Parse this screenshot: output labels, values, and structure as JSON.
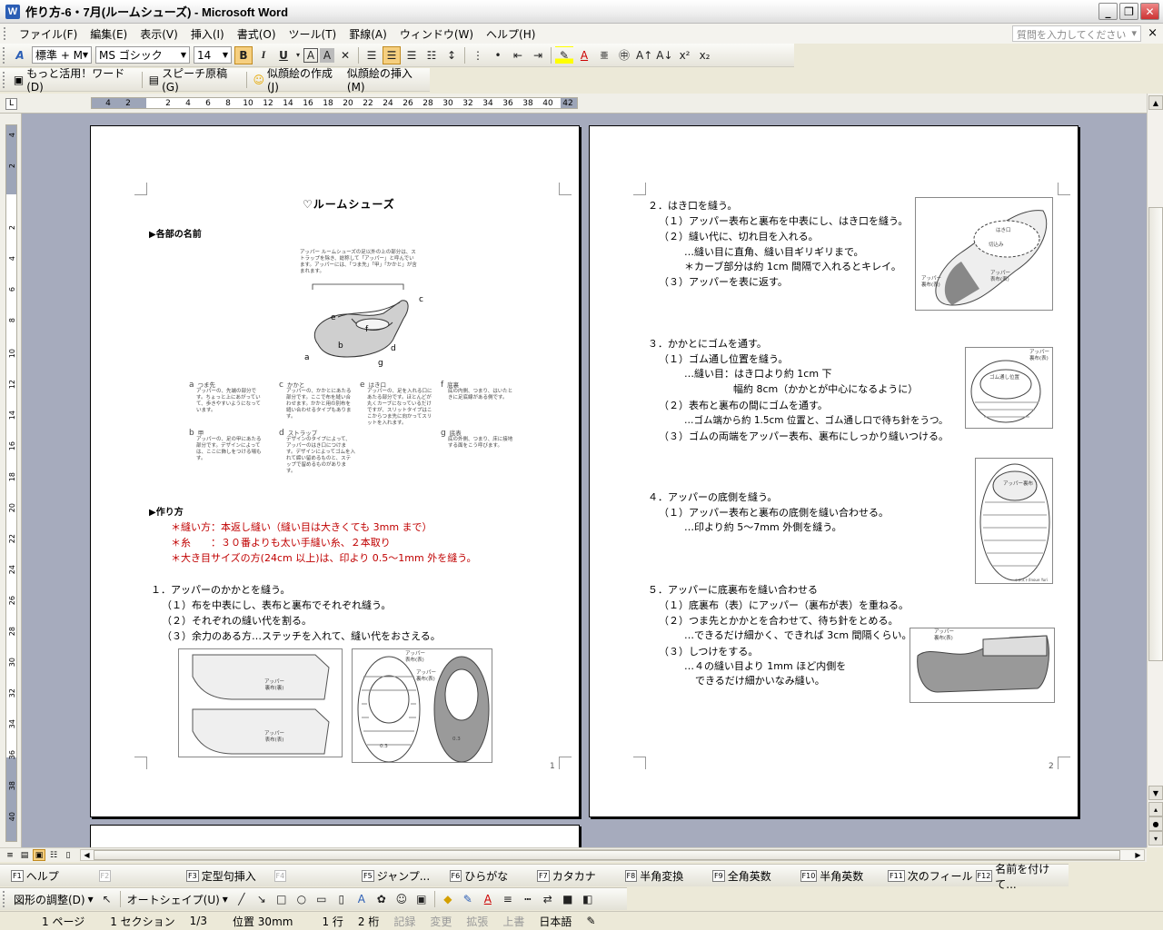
{
  "window": {
    "title": "作り方-6・7月(ルームシューズ) - Microsoft Word",
    "app_icon": "W",
    "min": "_",
    "restore": "❐",
    "close": "✕"
  },
  "menu": {
    "items": [
      "ファイル(F)",
      "編集(E)",
      "表示(V)",
      "挿入(I)",
      "書式(O)",
      "ツール(T)",
      "罫線(A)",
      "ウィンドウ(W)",
      "ヘルプ(H)"
    ],
    "help_placeholder": "質問を入力してください",
    "close_doc": "×"
  },
  "formatting": {
    "style": "標準 + M",
    "font": "MS ゴシック",
    "size": "14"
  },
  "toolbar2": {
    "motto": "もっと活用！ワード(D)",
    "speech": "スピーチ原稿(G)",
    "nigao_make": "似顔絵の作成(J)",
    "nigao_insert": "似顔絵の挿入(M)"
  },
  "ruler": {
    "numbers": [
      "4",
      "2",
      "",
      "2",
      "4",
      "6",
      "8",
      "10",
      "12",
      "14",
      "16",
      "18",
      "20",
      "22",
      "24",
      "26",
      "28",
      "30",
      "32",
      "34",
      "36",
      "38",
      "40",
      "42"
    ]
  },
  "vruler": {
    "numbers": [
      "4",
      "2",
      "",
      "2",
      "4",
      "6",
      "8",
      "10",
      "12",
      "14",
      "16",
      "18",
      "20",
      "22",
      "24",
      "26",
      "28",
      "30",
      "32",
      "34",
      "36",
      "38",
      "40"
    ]
  },
  "page1": {
    "title": "ルームシューズ",
    "section1": "▶各部の名前",
    "upper_caption": "アッパー\nルームシューズの足以外の上の部分は、ストラップを除き、総称して「アッパー」と呼んでいます。アッパーには、「つま先」「甲」「かかと」が含まれます。",
    "diagram_letters": [
      "a",
      "b",
      "c",
      "d",
      "e",
      "f",
      "g"
    ],
    "parts": [
      {
        "k": "a",
        "name": "つま先",
        "desc": "アッパーの、先端の部分です。ちょっと上にあがっていて、歩きやすいようになっています。"
      },
      {
        "k": "b",
        "name": "甲",
        "desc": "アッパーの、足の甲にあたる部分です。デザインによっては、ここに飾しをつける場もす。"
      },
      {
        "k": "c",
        "name": "かかと",
        "desc": "アッパーの、かかとにあたる部分です。ここで布を縫い合わせます。かかと用の別布を縫い合わせるタイプもあります。"
      },
      {
        "k": "d",
        "name": "ストラップ",
        "desc": "デザインのタイプによって、アッパーのはき口につけます。デザインによってゴムを入れて締い留めるものと、ステップで留めるものがあります。"
      },
      {
        "k": "e",
        "name": "はき口",
        "desc": "アッパーの、足を入れる口にあたる部分です。ほとんどが丸くカーブになっているだけですが、スリットタイプはここからつま先に向かってスリットを入れます。"
      },
      {
        "k": "f",
        "name": "底裏",
        "desc": "底の内側、つまり、はいたときに足底線がある側です。"
      },
      {
        "k": "g",
        "name": "底表",
        "desc": "底の外側、つまり、床に接地する面をこう呼びます。"
      }
    ],
    "section2": "▶作り方",
    "notes": [
      "＊縫い方：本返し縫い（縫い目は大きくても 3mm まで）",
      "＊糸　　：３０番よりも太い手縫い糸、２本取り",
      "＊大き目サイズの方(24cm 以上)は、印より 0.5～1mm 外を縫う。"
    ],
    "step1": [
      "１．アッパーのかかとを縫う。",
      "（１）布を中表にし、表布と裏布でそれぞれ縫う。",
      "（２）それぞれの縫い代を割る。",
      "（３）余力のある方…ステッチを入れて、縫い代をおさえる。"
    ],
    "fig_labels": {
      "upper_front": "アッパー\n裏布(裏)",
      "upper_back": "アッパー\n表布(表)",
      "a1": "アッパー\n表布(表)",
      "a2": "アッパー\n裏布(表)",
      "m1": "0.3",
      "m2": "0.3"
    },
    "page_number": "1"
  },
  "page2": {
    "step2": [
      "２．はき口を縫う。",
      "（１）アッパー表布と裏布を中表にし、はき口を縫う。",
      "（２）縫い代に、切れ目を入れる。",
      "…縫い目に直角、縫い目ギリギリまで。",
      "＊カーブ部分は約 1cm 間隔で入れるとキレイ。",
      "（３）アッパーを表に返す。"
    ],
    "step3": [
      "３．かかとにゴムを通す。",
      "（１）ゴム通し位置を縫う。",
      "…縫い目：はき口より約 1cm 下",
      "幅約 8cm（かかとが中心になるように）",
      "（２）表布と裏布の間にゴムを通す。",
      "…ゴム端から約 1.5cm 位置と、ゴム通し口で待ち針をうつ。",
      "（３）ゴムの両端をアッパー表布、裏布にしっかり縫いつける。"
    ],
    "step4": [
      "４．アッパーの底側を縫う。",
      "（１）アッパー表布と裏布の底側を縫い合わせる。",
      "…印より約 5～7mm 外側を縫う。"
    ],
    "step5": [
      "５．アッパーに底裏布を縫い合わせる",
      "（１）底裏布（表）にアッパー（裏布が表）を重ねる。",
      "（２）つま先とかかとを合わせて、待ち針をとめる。",
      "…できるだけ細かく、できれば 3cm 間隔くらい。",
      "（３）しつけをする。",
      "…４の縫い目より 1mm ほど内側を",
      "できるだけ細かいなみ縫い。"
    ],
    "fig_labels": {
      "hakiguchi": "はき口",
      "kirikomi": "切込み",
      "urafu": "アッパー\n裏布(表)",
      "omotefu": "アッパー\n表布(表)",
      "gomu_label": "アッパー\n裏布(表)",
      "gomu_pos": "ゴム通し位置",
      "upper_ura": "アッパー裏布",
      "upper4": "アッパー\n裏布(表)",
      "credit": "イラスト/Inoue Yuri"
    },
    "page_number": "2"
  },
  "fkeys": [
    {
      "k": "F1",
      "label": "ヘルプ",
      "enabled": true
    },
    {
      "k": "F2",
      "label": "",
      "enabled": false
    },
    {
      "k": "F3",
      "label": "定型句挿入",
      "enabled": true
    },
    {
      "k": "F4",
      "label": "",
      "enabled": false
    },
    {
      "k": "F5",
      "label": "ジャンプ...",
      "enabled": true
    },
    {
      "k": "F6",
      "label": "ひらがな",
      "enabled": true
    },
    {
      "k": "F7",
      "label": "カタカナ",
      "enabled": true
    },
    {
      "k": "F8",
      "label": "半角変換",
      "enabled": true
    },
    {
      "k": "F9",
      "label": "全角英数",
      "enabled": true
    },
    {
      "k": "F10",
      "label": "半角英数",
      "enabled": true
    },
    {
      "k": "F11",
      "label": "次のフィールド",
      "enabled": true
    },
    {
      "k": "F12",
      "label": "名前を付けて...",
      "enabled": true
    }
  ],
  "drawing": {
    "adjust": "図形の調整(D)",
    "autoshape": "オートシェイプ(U)"
  },
  "status": {
    "page": "1 ページ",
    "section": "1 セクション",
    "pages": "1/3",
    "position": "位置 30mm",
    "line": "1 行",
    "col": "2 桁",
    "rec": "記録",
    "trk": "変更",
    "ext": "拡張",
    "ovr": "上書",
    "lang": "日本語"
  },
  "colors": {
    "accent_red": "#c00000",
    "workspace": "#a6abbd",
    "highlight": "#f6cf7f"
  }
}
